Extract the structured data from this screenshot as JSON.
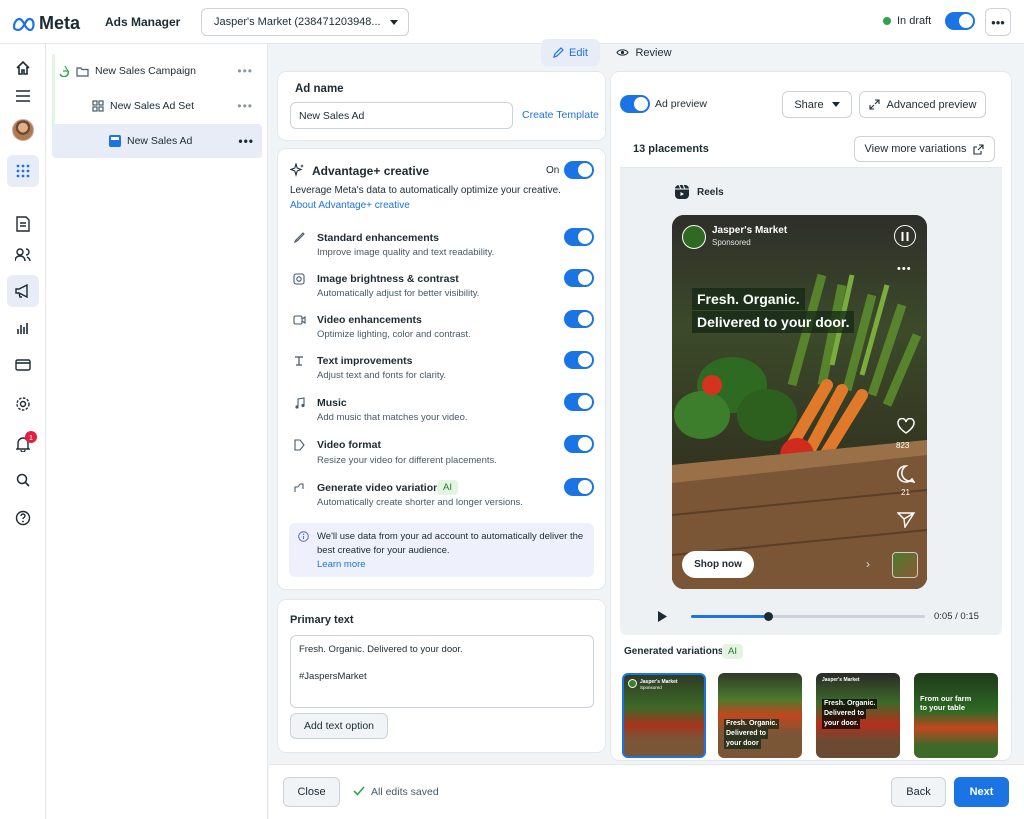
{
  "header": {
    "logo_text": "Meta",
    "app_title": "Ads Manager",
    "account_selector": "Jasper's Market (238471203948...",
    "status": "In draft",
    "more_icon": "ellipsis-icon"
  },
  "mode_tabs": [
    {
      "label": "Edit"
    },
    {
      "label": "Review"
    }
  ],
  "tree": {
    "campaign": "New Sales Campaign",
    "ad_set": "New Sales Ad Set",
    "ad": "New Sales Ad"
  },
  "notifications_count": "1",
  "ad_name": {
    "label": "Ad name",
    "value": "New Sales Ad",
    "create_template": "Create Template"
  },
  "advantage": {
    "title": "Advantage+ creative",
    "state": "On",
    "description": "Leverage Meta's data to automatically optimize your creative.",
    "about_link": "About Advantage+ creative",
    "options": [
      {
        "title": "Standard enhancements",
        "desc": "Improve image quality and text readability.",
        "icon": "brush-icon"
      },
      {
        "title": "Image brightness & contrast",
        "desc": "Automatically adjust for better visibility.",
        "icon": "brightness-icon"
      },
      {
        "title": "Video enhancements",
        "desc": "Optimize lighting, color and contrast.",
        "icon": "video-icon"
      },
      {
        "title": "Text improvements",
        "desc": "Adjust text and fonts for clarity.",
        "icon": "text-icon"
      },
      {
        "title": "Music",
        "desc": "Add music that matches your video.",
        "icon": "music-icon"
      },
      {
        "title": "Video format",
        "desc": "Resize your video for different placements.",
        "icon": "format-icon"
      },
      {
        "title": "Generate video variations",
        "desc": "Automatically create shorter and longer versions.",
        "icon": "variations-icon",
        "badge": "AI"
      }
    ],
    "info_text_1": "We'll use data from your ad account to automatically deliver the",
    "info_text_2": "best creative for your audience.",
    "learn_more": "Learn more"
  },
  "primary_text": {
    "label": "Primary text",
    "line1": "Fresh. Organic. Delivered to your door.",
    "line2": "#JaspersMarket",
    "add_option": "Add text option"
  },
  "footer": {
    "close": "Close",
    "saved": "All edits saved",
    "back": "Back",
    "next": "Next"
  },
  "preview": {
    "toggle_label": "Ad preview",
    "share": "Share",
    "advanced": "Advanced preview",
    "placements": "13 placements",
    "view_more": "View more variations",
    "placement_name": "Reels",
    "brand": "Jasper's Market",
    "sponsored": "Sponsored",
    "headline_1": "Fresh. Organic.",
    "headline_2": "Delivered to your door.",
    "likes": "823",
    "comments": "21",
    "cta": "Shop now",
    "time": "0:05 / 0:15",
    "progress": 0.33,
    "variations_label": "Generated variations",
    "variations_badge": "AI",
    "thumbs": [
      {
        "l1": "Jasper's Market",
        "l2": "Sponsored",
        "l3": "",
        "l4": ""
      },
      {
        "l1": "Fresh. Organic.",
        "l2": "Delivered to",
        "l3": "your door",
        "l4": ""
      },
      {
        "l1": "Jasper's Market",
        "l2": "Fresh. Organic.",
        "l3": "Delivered to",
        "l4": "your door."
      },
      {
        "l1": "From our farm",
        "l2": "to your table",
        "l3": "",
        "l4": ""
      }
    ]
  },
  "colors": {
    "accent": "#1b74e4",
    "badge_green": "#e3f5e1",
    "info_bg": "#eef1fb"
  }
}
